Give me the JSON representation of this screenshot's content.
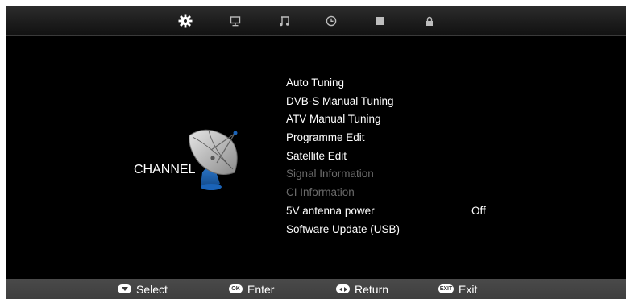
{
  "tabs": [
    {
      "icon": "gear-icon",
      "label": "Channel",
      "active": true
    },
    {
      "icon": "monitor-icon",
      "label": "Picture",
      "active": false
    },
    {
      "icon": "music-note-icon",
      "label": "Sound",
      "active": false
    },
    {
      "icon": "clock-icon",
      "label": "Time",
      "active": false
    },
    {
      "icon": "square-icon",
      "label": "Option",
      "active": false
    },
    {
      "icon": "lock-icon",
      "label": "Lock",
      "active": false
    }
  ],
  "section": {
    "title": "CHANNEL",
    "icon": "satellite-dish-icon"
  },
  "menu": {
    "items": [
      {
        "label": "Auto Tuning",
        "enabled": true
      },
      {
        "label": "DVB-S Manual Tuning",
        "enabled": true
      },
      {
        "label": "ATV Manual Tuning",
        "enabled": true
      },
      {
        "label": "Programme Edit",
        "enabled": true
      },
      {
        "label": "Satellite Edit",
        "enabled": true
      },
      {
        "label": "Signal Information",
        "enabled": false
      },
      {
        "label": "CI Information",
        "enabled": false
      },
      {
        "label": "5V antenna power",
        "enabled": true,
        "value": "Off"
      },
      {
        "label": "Software Update (USB)",
        "enabled": true
      }
    ]
  },
  "footer": {
    "select": {
      "key": "down-arrow-key-icon",
      "label": "Select"
    },
    "enter": {
      "key": "OK",
      "label": "Enter"
    },
    "return": {
      "key": "left-right-arrow-key-icon",
      "label": "Return"
    },
    "exit": {
      "key": "EXIT",
      "label": "Exit"
    }
  },
  "colors": {
    "background": "#000000",
    "text": "#ffffff",
    "disabled_text": "#6a6a6a",
    "footer": "#444444",
    "dish_blue": "#1f5fa6"
  }
}
